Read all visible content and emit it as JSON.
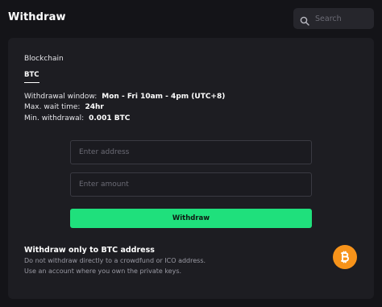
{
  "header": {
    "title": "Withdraw",
    "search_placeholder": "Search"
  },
  "form": {
    "section_label": "Blockchain",
    "active_tab": "BTC",
    "info": [
      {
        "label": "Withdrawal window:",
        "value": "Mon - Fri 10am - 4pm (UTC+8)"
      },
      {
        "label": "Max. wait time:",
        "value": "24hr"
      },
      {
        "label": "Min. withdrawal:",
        "value": "0.001 BTC"
      }
    ],
    "address_placeholder": "Enter address",
    "amount_placeholder": "Enter amount",
    "submit_label": "Withdraw"
  },
  "notice": {
    "title": "Withdraw only to BTC address",
    "lines": [
      "Do not withdraw directly to a crowdfund or ICO address.",
      "Use an account where you own the private keys."
    ]
  },
  "icons": {
    "search": "search-icon",
    "currency": "bitcoin-icon"
  },
  "colors": {
    "accent": "#1fe07c",
    "bitcoin": "#f7931a",
    "background": "#141418",
    "card": "#1d1d22"
  }
}
